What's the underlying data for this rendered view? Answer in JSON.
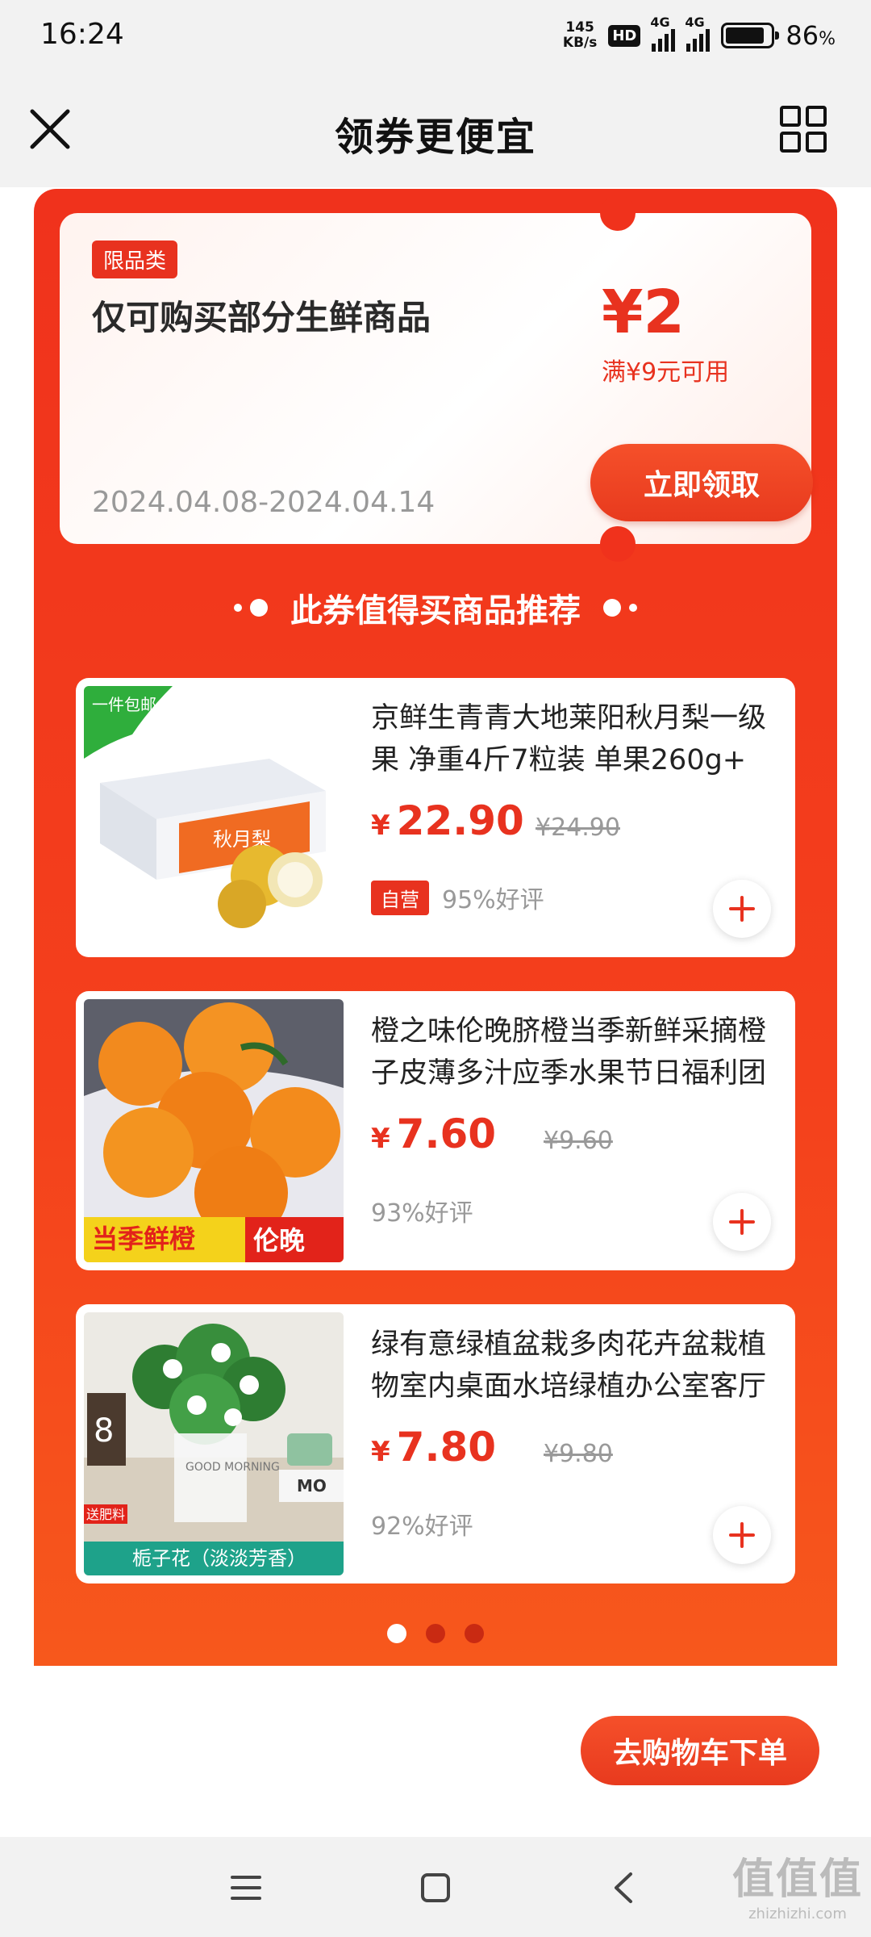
{
  "status_bar": {
    "time": "16:24",
    "net_speed_value": "145",
    "net_speed_unit": "KB/s",
    "hd_badge": "HD",
    "network_1": "4G",
    "network_2": "4G",
    "battery_percent": "86",
    "battery_unit": "%"
  },
  "header": {
    "title": "领券更便宜",
    "close_icon": "close-icon",
    "grid_icon": "grid-icon"
  },
  "coupon": {
    "tag": "限品类",
    "description": "仅可购买部分生鲜商品",
    "amount": "¥2",
    "condition": "满¥9元可用",
    "dates": "2024.04.08-2024.04.14",
    "claim_label": "立即领取"
  },
  "section": {
    "title": "此券值得买商品推荐"
  },
  "products": [
    {
      "name": "京鲜生青青大地莱阳秋月梨一级果 净重4斤7粒装 单果260g+",
      "currency": "¥",
      "price": "22.90",
      "original_price": "¥24.90",
      "self_tag": "自营",
      "rating": "95%好评",
      "thumb_corner_tag": "一件包邮",
      "thumb_box_text": "秋月梨"
    },
    {
      "name": "橙之味伦晚脐橙当季新鲜采摘橙子皮薄多汁应季水果节日福利团",
      "currency": "¥",
      "price": "7.60",
      "original_price": "¥9.60",
      "rating": "93%好评",
      "thumb_banner_left": "当季鲜橙",
      "thumb_banner_right": "伦晚"
    },
    {
      "name": "绿有意绿植盆栽多肉花卉盆栽植物室内桌面水培绿植办公室客厅",
      "currency": "¥",
      "price": "7.80",
      "original_price": "¥9.80",
      "rating": "92%好评",
      "thumb_corner_tag": "送肥料",
      "thumb_caption": "栀子花（淡淡芳香）",
      "thumb_pot_text": "GOOD MORNING",
      "thumb_book_text": "MO",
      "thumb_calendar": "8"
    }
  ],
  "pager": {
    "count": 3,
    "active": 0
  },
  "checkout": {
    "label": "去购物车下单"
  },
  "watermark": {
    "big": "值值值",
    "small": "zhizhizhi.com"
  },
  "colors": {
    "primary": "#e8321f",
    "panel": "#f0321c",
    "text": "#222222",
    "muted": "#999999"
  }
}
